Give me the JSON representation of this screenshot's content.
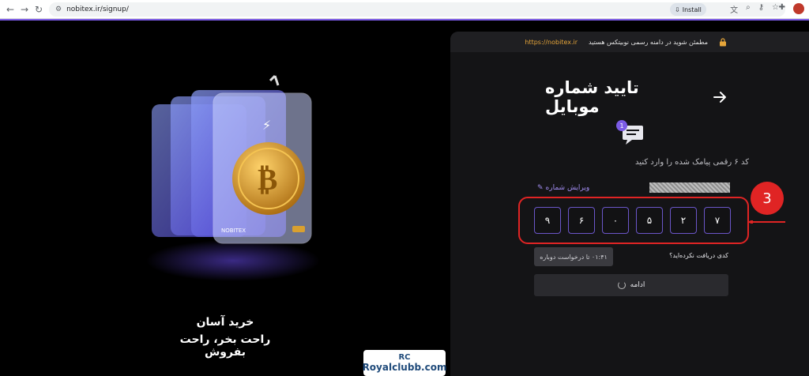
{
  "browser": {
    "url": "nobitex.ir/signup/",
    "install_label": "Install"
  },
  "banner": {
    "secure_text": "مطمئن شوید در دامنه رسمی نوبیتکس هستید",
    "secure_url": "https://nobitex.ir"
  },
  "page": {
    "title": "تایید شماره موبایل",
    "message_badge": "1",
    "instruction": "کد ۶ رقمی پیامک شده را وارد کنید",
    "edit_number": "ویرایش شماره",
    "otp_digits": [
      "۹",
      "۶",
      "۰",
      "۵",
      "۲",
      "۷"
    ],
    "resend_label": "۰۱:۴۱ تا درخواست دوباره",
    "no_code_label": "کدی دریافت نکرده‌اید؟",
    "continue_label": "ادامه"
  },
  "promo": {
    "line1": "خرید آسان",
    "line2": "راحت بخر، راحت بفروش",
    "card_brand": "NOBITEX"
  },
  "annotation": {
    "step_number": "3",
    "color": "#e02424"
  },
  "watermark": {
    "logo": "RC",
    "text": "Royalclubb.com"
  },
  "colors": {
    "accent": "#7b5be5",
    "secure_url": "#e6a53a",
    "bitcoin": "#d9a02f"
  }
}
